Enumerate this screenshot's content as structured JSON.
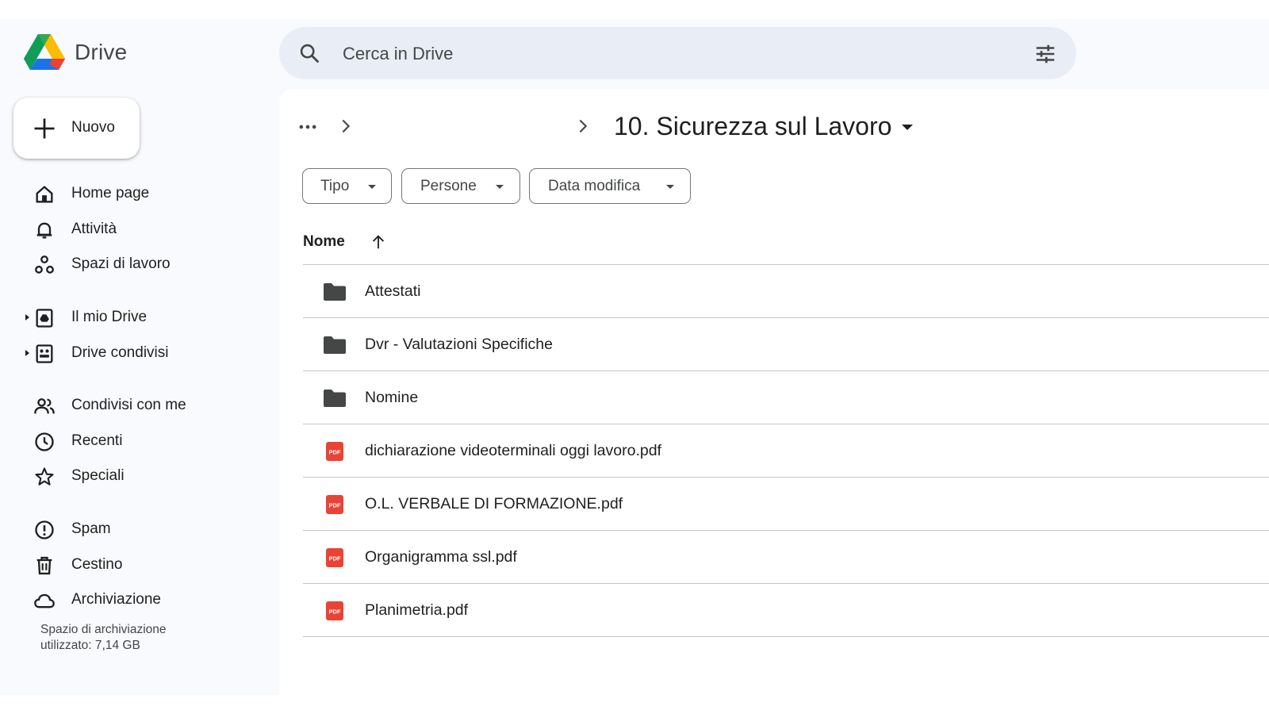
{
  "header": {
    "app_name": "Drive",
    "search_placeholder": "Cerca in Drive"
  },
  "sidebar": {
    "new_label": "Nuovo",
    "items": [
      {
        "label": "Home page",
        "icon": "home-icon"
      },
      {
        "label": "Attività",
        "icon": "bell-icon"
      },
      {
        "label": "Spazi di lavoro",
        "icon": "workspaces-icon"
      },
      {
        "label": "Il mio Drive",
        "icon": "my-drive-icon",
        "expandable": true
      },
      {
        "label": "Drive condivisi",
        "icon": "shared-drives-icon",
        "expandable": true
      },
      {
        "label": "Condivisi con me",
        "icon": "people-icon"
      },
      {
        "label": "Recenti",
        "icon": "clock-icon"
      },
      {
        "label": "Speciali",
        "icon": "star-icon"
      },
      {
        "label": "Spam",
        "icon": "spam-icon"
      },
      {
        "label": "Cestino",
        "icon": "trash-icon"
      },
      {
        "label": "Archiviazione",
        "icon": "cloud-icon"
      }
    ],
    "storage_line1": "Spazio di archiviazione",
    "storage_line2": "utilizzato: 7,14 GB"
  },
  "breadcrumb": {
    "more": "•••",
    "current_folder": "10. Sicurezza sul Lavoro"
  },
  "filters": [
    {
      "label": "Tipo"
    },
    {
      "label": "Persone"
    },
    {
      "label": "Data modifica"
    }
  ],
  "table": {
    "column_name": "Nome",
    "sort": "ascending",
    "rows": [
      {
        "name": "Attestati",
        "type": "folder"
      },
      {
        "name": "Dvr - Valutazioni Specifiche",
        "type": "folder"
      },
      {
        "name": "Nomine",
        "type": "folder"
      },
      {
        "name": "dichiarazione videoterminali oggi lavoro.pdf",
        "type": "pdf"
      },
      {
        "name": "O.L. VERBALE DI FORMAZIONE.pdf",
        "type": "pdf"
      },
      {
        "name": "Organigramma ssl.pdf",
        "type": "pdf"
      },
      {
        "name": "Planimetria.pdf",
        "type": "pdf"
      }
    ]
  },
  "colors": {
    "background": "#f8fafd",
    "search_bg": "#e9eef6",
    "pdf_red": "#ea4335",
    "folder_gray": "#444746"
  }
}
